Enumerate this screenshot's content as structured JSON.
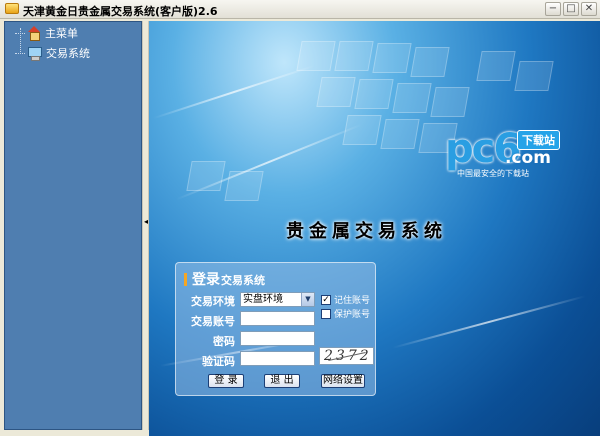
{
  "window": {
    "title": "天津黄金日贵金属交易系统(客户版)2.6",
    "buttons": {
      "minimize": "−",
      "maximize": "□",
      "close": "✕"
    }
  },
  "sidebar": {
    "items": [
      {
        "label": "主菜单",
        "icon": "home-icon"
      },
      {
        "label": "交易系统",
        "icon": "computer-icon"
      }
    ]
  },
  "splitter": {
    "arrow": "◂"
  },
  "brand": {
    "logo_main": "pc6",
    "logo_badge": "下载站",
    "logo_dotcom": ".com",
    "logo_tagline": "中国最安全的下载站"
  },
  "main": {
    "system_title": "贵金属交易系统"
  },
  "login": {
    "title_big": "登录",
    "title_small": "交易系统",
    "env_label": "交易环境",
    "env_value": "实盘环境",
    "account_label": "交易账号",
    "account_value": "",
    "password_label": "密码",
    "password_value": "",
    "captcha_label": "验证码",
    "captcha_value": "",
    "captcha_image_text": "2372",
    "remember_label": "记住账号",
    "remember_checked": true,
    "protect_label": "保护账号",
    "protect_checked": false,
    "login_button": "登 录",
    "exit_button": "退 出",
    "network_button": "网络设置"
  }
}
